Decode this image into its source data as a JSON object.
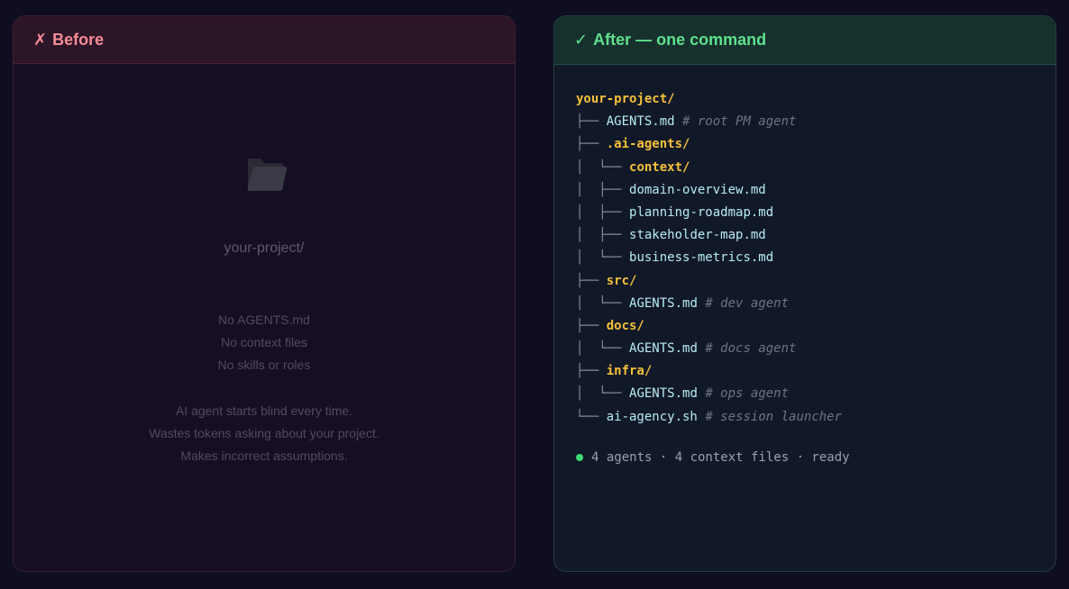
{
  "before": {
    "mark": "✗",
    "title": "Before",
    "icon": "folder-icon",
    "project": "your-project/",
    "missing": [
      "No AGENTS.md",
      "No context files",
      "No skills or roles"
    ],
    "consequences": [
      "AI agent starts blind every time.",
      "Wastes tokens asking about your project.",
      "Makes incorrect assumptions."
    ]
  },
  "after": {
    "mark": "✓",
    "title": "After — one command",
    "tree": [
      {
        "prefix": "",
        "name": "your-project/",
        "kind": "dir",
        "comment": ""
      },
      {
        "prefix": "├── ",
        "name": "AGENTS.md",
        "kind": "file",
        "comment": "# root PM agent"
      },
      {
        "prefix": "├── ",
        "name": ".ai-agents/",
        "kind": "dir",
        "comment": ""
      },
      {
        "prefix": "│  └── ",
        "name": "context/",
        "kind": "dir",
        "comment": ""
      },
      {
        "prefix": "│  ├── ",
        "name": "domain-overview.md",
        "kind": "file",
        "comment": ""
      },
      {
        "prefix": "│  ├── ",
        "name": "planning-roadmap.md",
        "kind": "file",
        "comment": ""
      },
      {
        "prefix": "│  ├── ",
        "name": "stakeholder-map.md",
        "kind": "file",
        "comment": ""
      },
      {
        "prefix": "│  └── ",
        "name": "business-metrics.md",
        "kind": "file",
        "comment": ""
      },
      {
        "prefix": "├── ",
        "name": "src/",
        "kind": "dir",
        "comment": ""
      },
      {
        "prefix": "│  └── ",
        "name": "AGENTS.md",
        "kind": "file",
        "comment": "# dev agent"
      },
      {
        "prefix": "├── ",
        "name": "docs/",
        "kind": "dir",
        "comment": ""
      },
      {
        "prefix": "│  └── ",
        "name": "AGENTS.md",
        "kind": "file",
        "comment": "# docs agent"
      },
      {
        "prefix": "├── ",
        "name": "infra/",
        "kind": "dir",
        "comment": ""
      },
      {
        "prefix": "│  └── ",
        "name": "AGENTS.md",
        "kind": "file",
        "comment": "# ops agent"
      },
      {
        "prefix": "└── ",
        "name": "ai-agency.sh",
        "kind": "file",
        "comment": "# session launcher"
      }
    ],
    "status": {
      "color": "#3bd873",
      "text": "4 agents · 4 context files · ready"
    }
  }
}
